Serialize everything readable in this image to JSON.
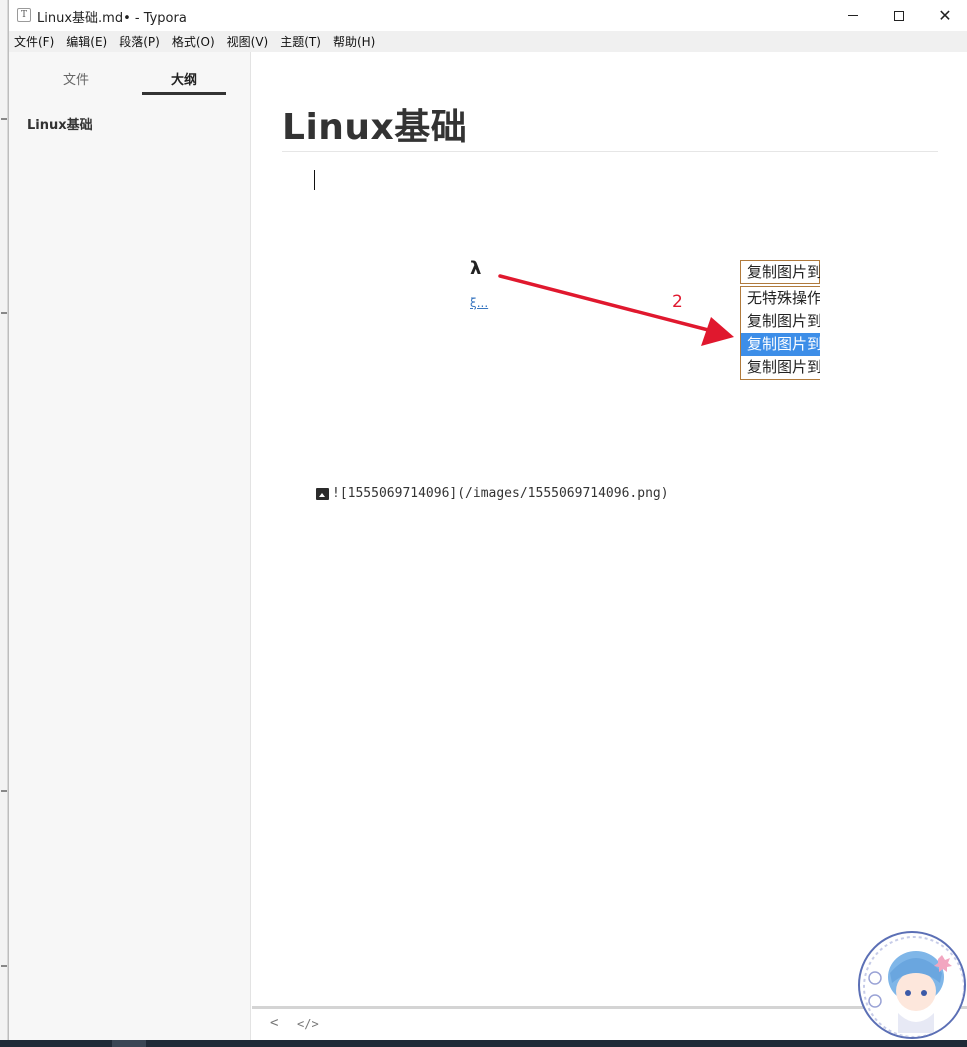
{
  "window": {
    "title": "Linux基础.md• - Typora",
    "app_icon_letter": "T"
  },
  "menu": [
    "文件(F)",
    "编辑(E)",
    "段落(P)",
    "格式(O)",
    "视图(V)",
    "主题(T)",
    "帮助(H)"
  ],
  "sidebar": {
    "tabs": [
      {
        "label": "文件",
        "active": false
      },
      {
        "label": "大纲",
        "active": true
      }
    ],
    "outline": [
      {
        "label": "Linux基础"
      }
    ]
  },
  "editor": {
    "heading": "Linux基础",
    "image": {
      "glyph_fragment": "λ",
      "link_fragment": "ξ...",
      "arrow_label": "2",
      "dropdown_head": "复制图片到",
      "dropdown_options": [
        {
          "label": "无特殊操作",
          "selected": false
        },
        {
          "label": "复制图片到",
          "selected": false
        },
        {
          "label": "复制图片到",
          "selected": true
        },
        {
          "label": "复制图片到",
          "selected": false
        }
      ]
    },
    "markdown_source": "![1555069714096](/images/1555069714096.png)"
  },
  "footer": {
    "back_glyph": "<",
    "source_toggle_glyph": "</>"
  },
  "colors": {
    "accent_selection": "#3d8ee8",
    "arrow_red": "#e0182e",
    "sidebar_bg": "#f7f7f7"
  }
}
